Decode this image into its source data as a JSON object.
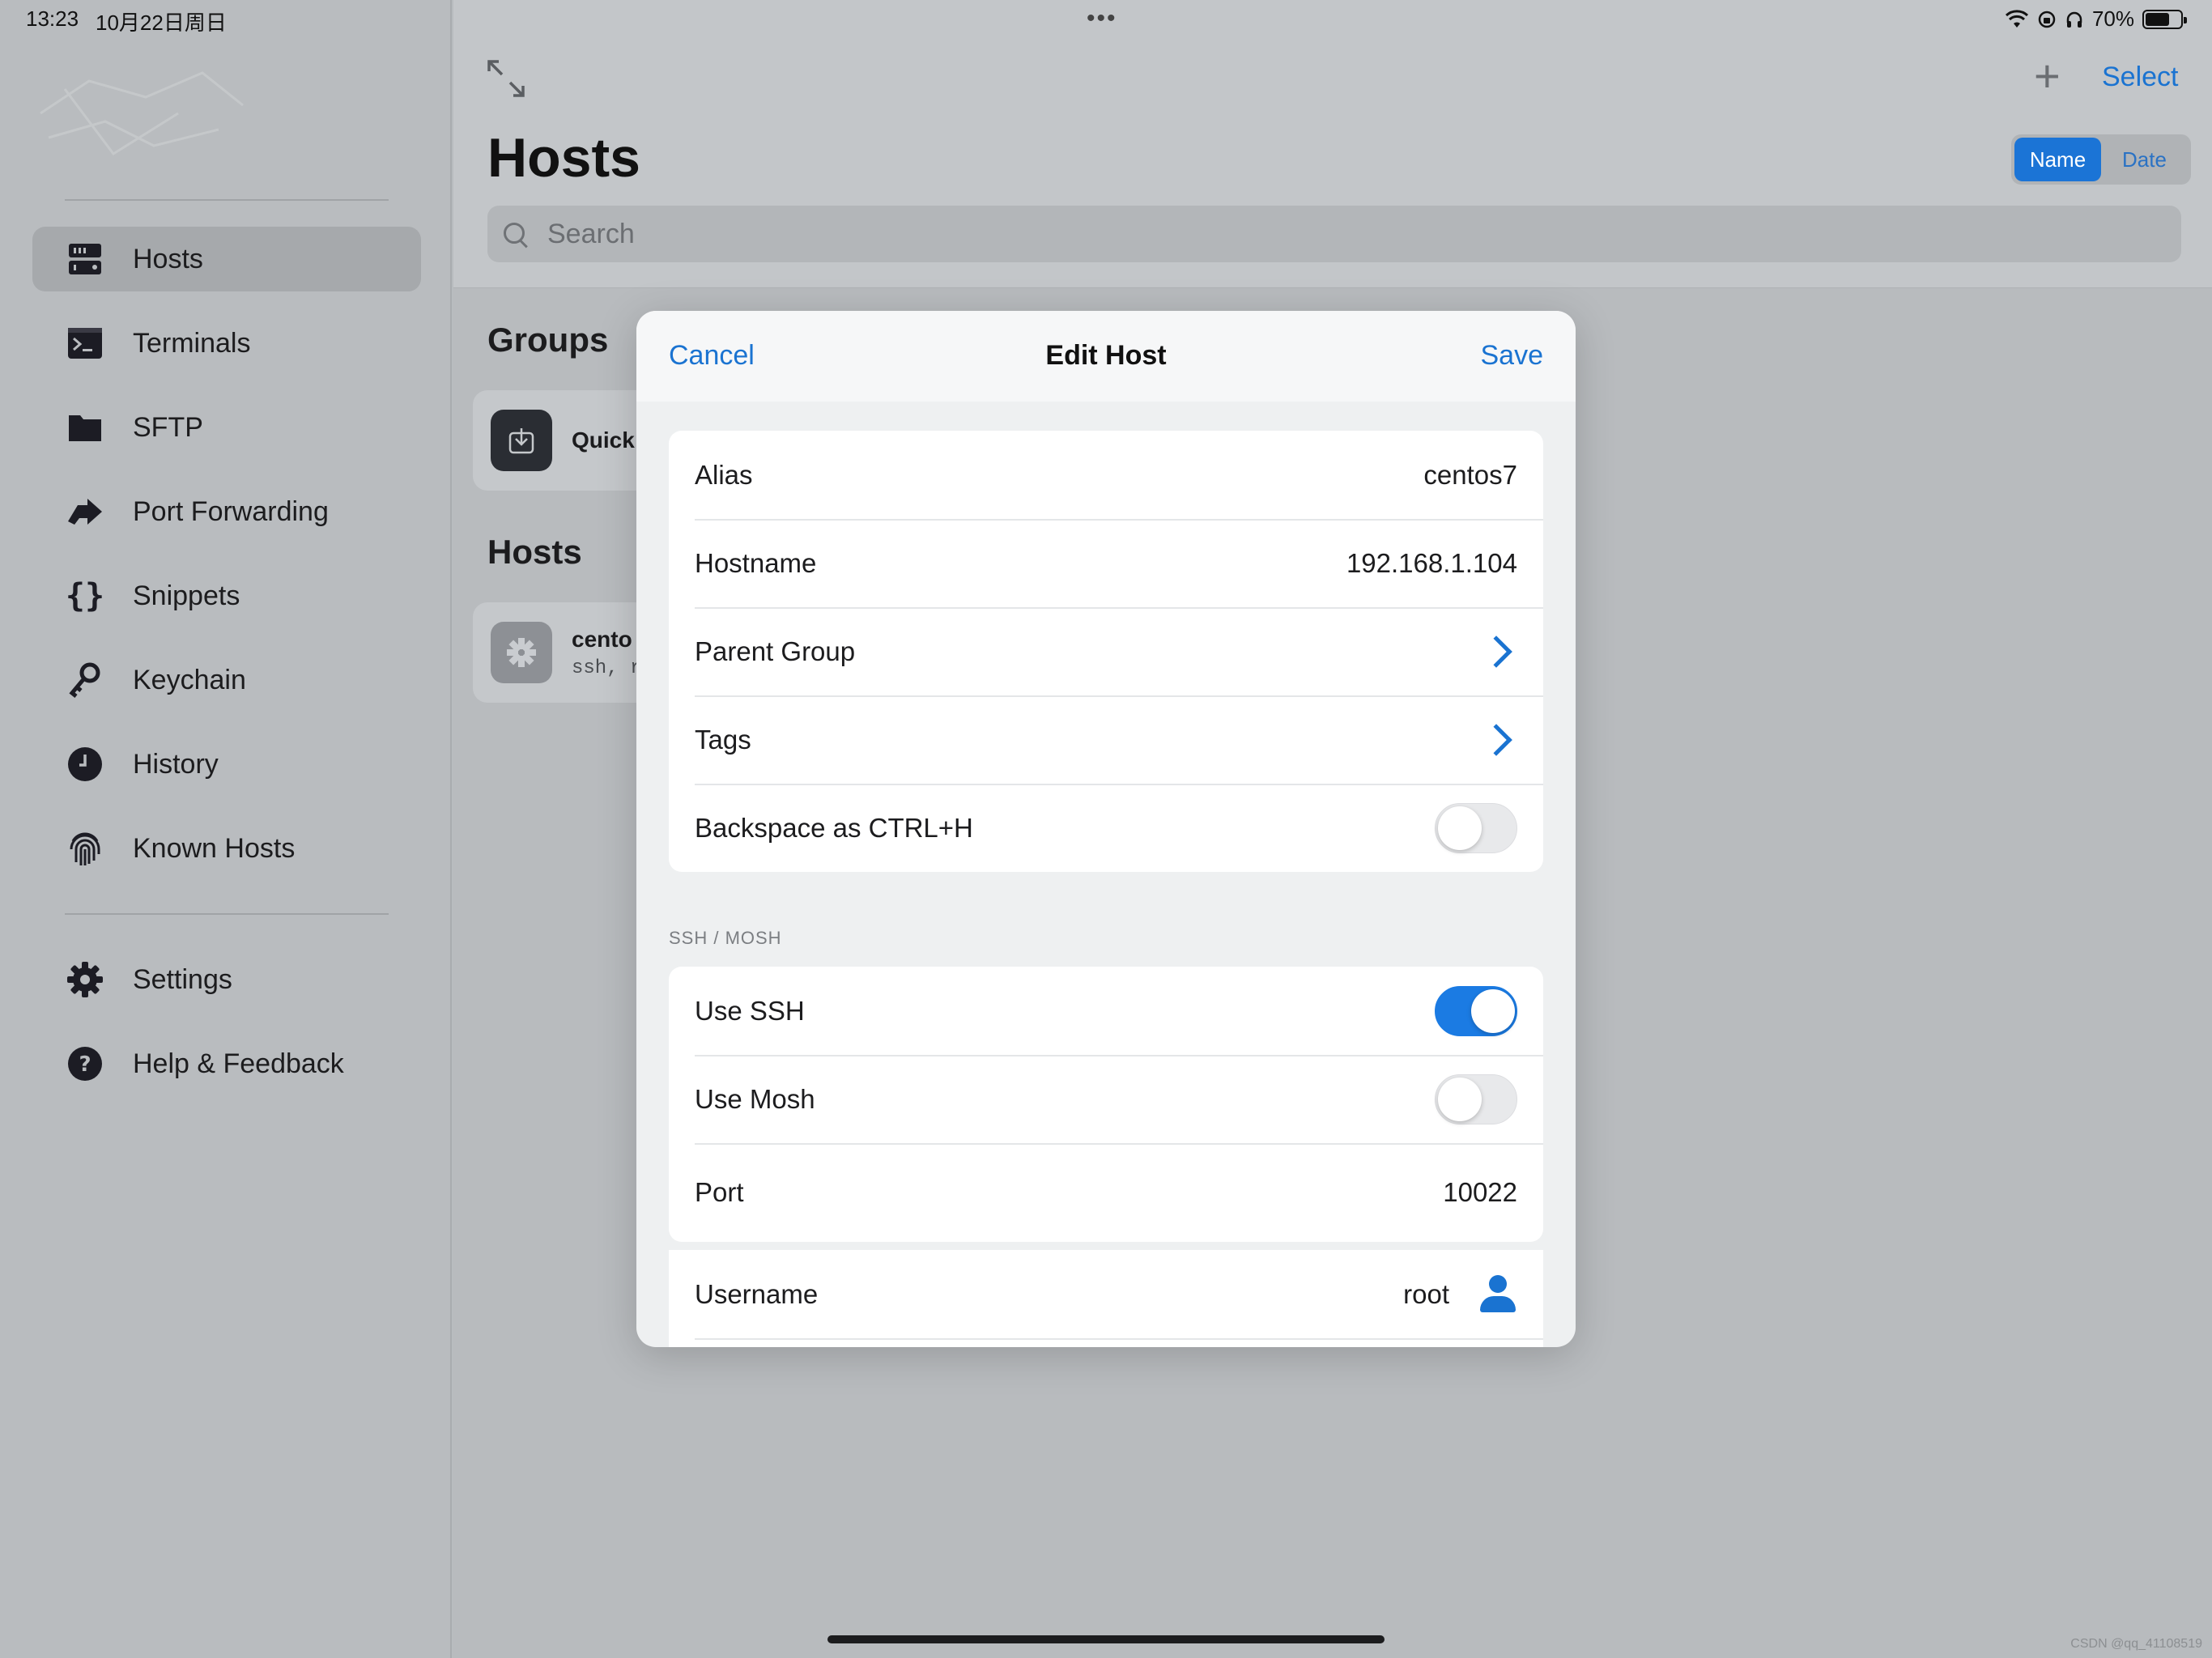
{
  "status": {
    "time": "13:23",
    "date": "10月22日周日",
    "battery": "70%",
    "battery_level": 0.7
  },
  "sidebar": {
    "items": [
      {
        "label": "Hosts",
        "icon": "server-icon"
      },
      {
        "label": "Terminals",
        "icon": "terminal-icon"
      },
      {
        "label": "SFTP",
        "icon": "folder-icon"
      },
      {
        "label": "Port Forwarding",
        "icon": "port-forward-icon"
      },
      {
        "label": "Snippets",
        "icon": "braces-icon"
      },
      {
        "label": "Keychain",
        "icon": "key-icon"
      },
      {
        "label": "History",
        "icon": "clock-icon"
      },
      {
        "label": "Known Hosts",
        "icon": "fingerprint-icon"
      }
    ],
    "footer_items": [
      {
        "label": "Settings",
        "icon": "gear-icon"
      },
      {
        "label": "Help & Feedback",
        "icon": "help-icon"
      }
    ],
    "active": "Hosts"
  },
  "main": {
    "title": "Hosts",
    "select_label": "Select",
    "sort": {
      "options": [
        "Name",
        "Date"
      ],
      "selected": "Name"
    },
    "search_placeholder": "Search",
    "groups_title": "Groups",
    "group_card": {
      "label": "Quick"
    },
    "hosts_title": "Hosts",
    "host_card": {
      "label": "cento",
      "sub": "ssh, r"
    }
  },
  "modal": {
    "cancel": "Cancel",
    "title": "Edit Host",
    "save": "Save",
    "general": {
      "alias_label": "Alias",
      "alias_value": "centos7",
      "hostname_label": "Hostname",
      "hostname_value": "192.168.1.104",
      "parent_group_label": "Parent Group",
      "tags_label": "Tags",
      "backspace_label": "Backspace as CTRL+H",
      "backspace_on": false
    },
    "ssh_section_label": "SSH / MOSH",
    "ssh": {
      "use_ssh_label": "Use SSH",
      "use_ssh_on": true,
      "use_mosh_label": "Use Mosh",
      "use_mosh_on": false,
      "port_label": "Port",
      "port_value": "10022"
    },
    "auth": {
      "username_label": "Username",
      "username_value": "root"
    }
  },
  "watermark": "CSDN @qq_41108519",
  "colors": {
    "accent": "#1a73d1",
    "toggle_on": "#1b7be3"
  }
}
